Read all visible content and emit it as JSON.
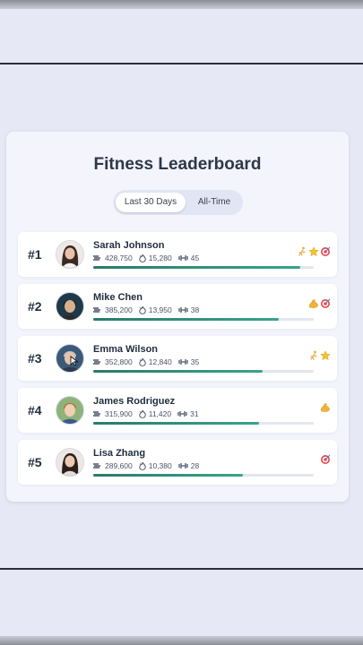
{
  "leaderboard": {
    "title": "Fitness Leaderboard",
    "tabs": [
      {
        "label": "Last 30 Days",
        "active": true
      },
      {
        "label": "All-Time",
        "active": false
      }
    ],
    "entries": [
      {
        "rank": "#1",
        "name": "Sarah Johnson",
        "steps": "428,750",
        "calories": "15,280",
        "workouts": "45",
        "progress": 0.94,
        "badges": [
          "runner-badge-icon",
          "star-badge-icon",
          "target-badge-icon"
        ]
      },
      {
        "rank": "#2",
        "name": "Mike Chen",
        "steps": "385,200",
        "calories": "13,950",
        "workouts": "38",
        "progress": 0.84,
        "badges": [
          "muscle-badge-icon",
          "target-badge-icon"
        ]
      },
      {
        "rank": "#3",
        "name": "Emma Wilson",
        "steps": "352,800",
        "calories": "12,840",
        "workouts": "35",
        "progress": 0.77,
        "badges": [
          "runner-badge-icon",
          "star-badge-icon"
        ]
      },
      {
        "rank": "#4",
        "name": "James Rodriguez",
        "steps": "315,900",
        "calories": "11,420",
        "workouts": "31",
        "progress": 0.75,
        "badges": [
          "muscle-badge-icon"
        ]
      },
      {
        "rank": "#5",
        "name": "Lisa Zhang",
        "steps": "289,600",
        "calories": "10,380",
        "workouts": "28",
        "progress": 0.68,
        "badges": [
          "target-badge-icon"
        ]
      }
    ]
  },
  "colors": {
    "background": "#e6e8f5",
    "card": "#f3f4fc",
    "progress": "#2f8c77",
    "track": "#e3e6ef"
  }
}
